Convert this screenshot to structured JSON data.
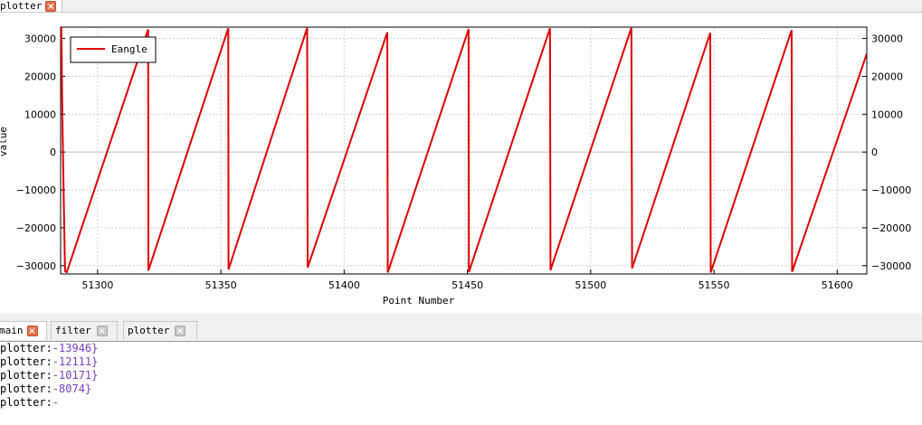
{
  "top_tabs": [
    {
      "label": "plotter",
      "active": true
    }
  ],
  "chart_data": {
    "type": "line",
    "title": "",
    "xlabel": "Point Number",
    "ylabel": "value",
    "xlim": [
      51285,
      51612
    ],
    "ylim": [
      -32200,
      33000
    ],
    "x_ticks": [
      51300,
      51350,
      51400,
      51450,
      51500,
      51550,
      51600
    ],
    "y_ticks": [
      30000,
      20000,
      10000,
      0,
      -10000,
      -20000,
      -30000
    ],
    "y_tick_labels": [
      "30000",
      "20000",
      "10000",
      "0",
      "−10000",
      "−20000",
      "−30000"
    ],
    "grid": true,
    "legend_position": "top-left",
    "series": [
      {
        "name": "Eangle",
        "color": "#e00000",
        "points": [
          [
            51285.3,
            33000
          ],
          [
            51285.7,
            10000
          ],
          [
            51286.2,
            -10000
          ],
          [
            51286.8,
            -31500
          ],
          [
            51287.5,
            -31700
          ],
          [
            51320.5,
            32400
          ],
          [
            51320.6,
            -31300
          ],
          [
            51353.0,
            32700
          ],
          [
            51353.1,
            -31000
          ],
          [
            51385.0,
            32800
          ],
          [
            51385.2,
            -30500
          ],
          [
            51417.5,
            31600
          ],
          [
            51417.7,
            -31800
          ],
          [
            51450.5,
            32500
          ],
          [
            51450.6,
            -31700
          ],
          [
            51483.5,
            32700
          ],
          [
            51483.7,
            -31200
          ],
          [
            51516.5,
            32800
          ],
          [
            51516.8,
            -30700
          ],
          [
            51548.5,
            31500
          ],
          [
            51548.7,
            -31800
          ],
          [
            51581.5,
            32200
          ],
          [
            51581.7,
            -31600
          ],
          [
            51612,
            26000
          ]
        ]
      }
    ]
  },
  "bottom_tabs": [
    {
      "label": "main",
      "active": true
    },
    {
      "label": "filter",
      "active": false
    },
    {
      "label": "plotter",
      "active": false
    }
  ],
  "console": [
    {
      "prefix": "plotter:",
      "value": "-13946}"
    },
    {
      "prefix": "plotter:",
      "value": "-12111}"
    },
    {
      "prefix": "plotter:",
      "value": "-10171}"
    },
    {
      "prefix": "plotter:",
      "value": "-8074}"
    },
    {
      "prefix": "plotter:",
      "value": "-"
    }
  ]
}
